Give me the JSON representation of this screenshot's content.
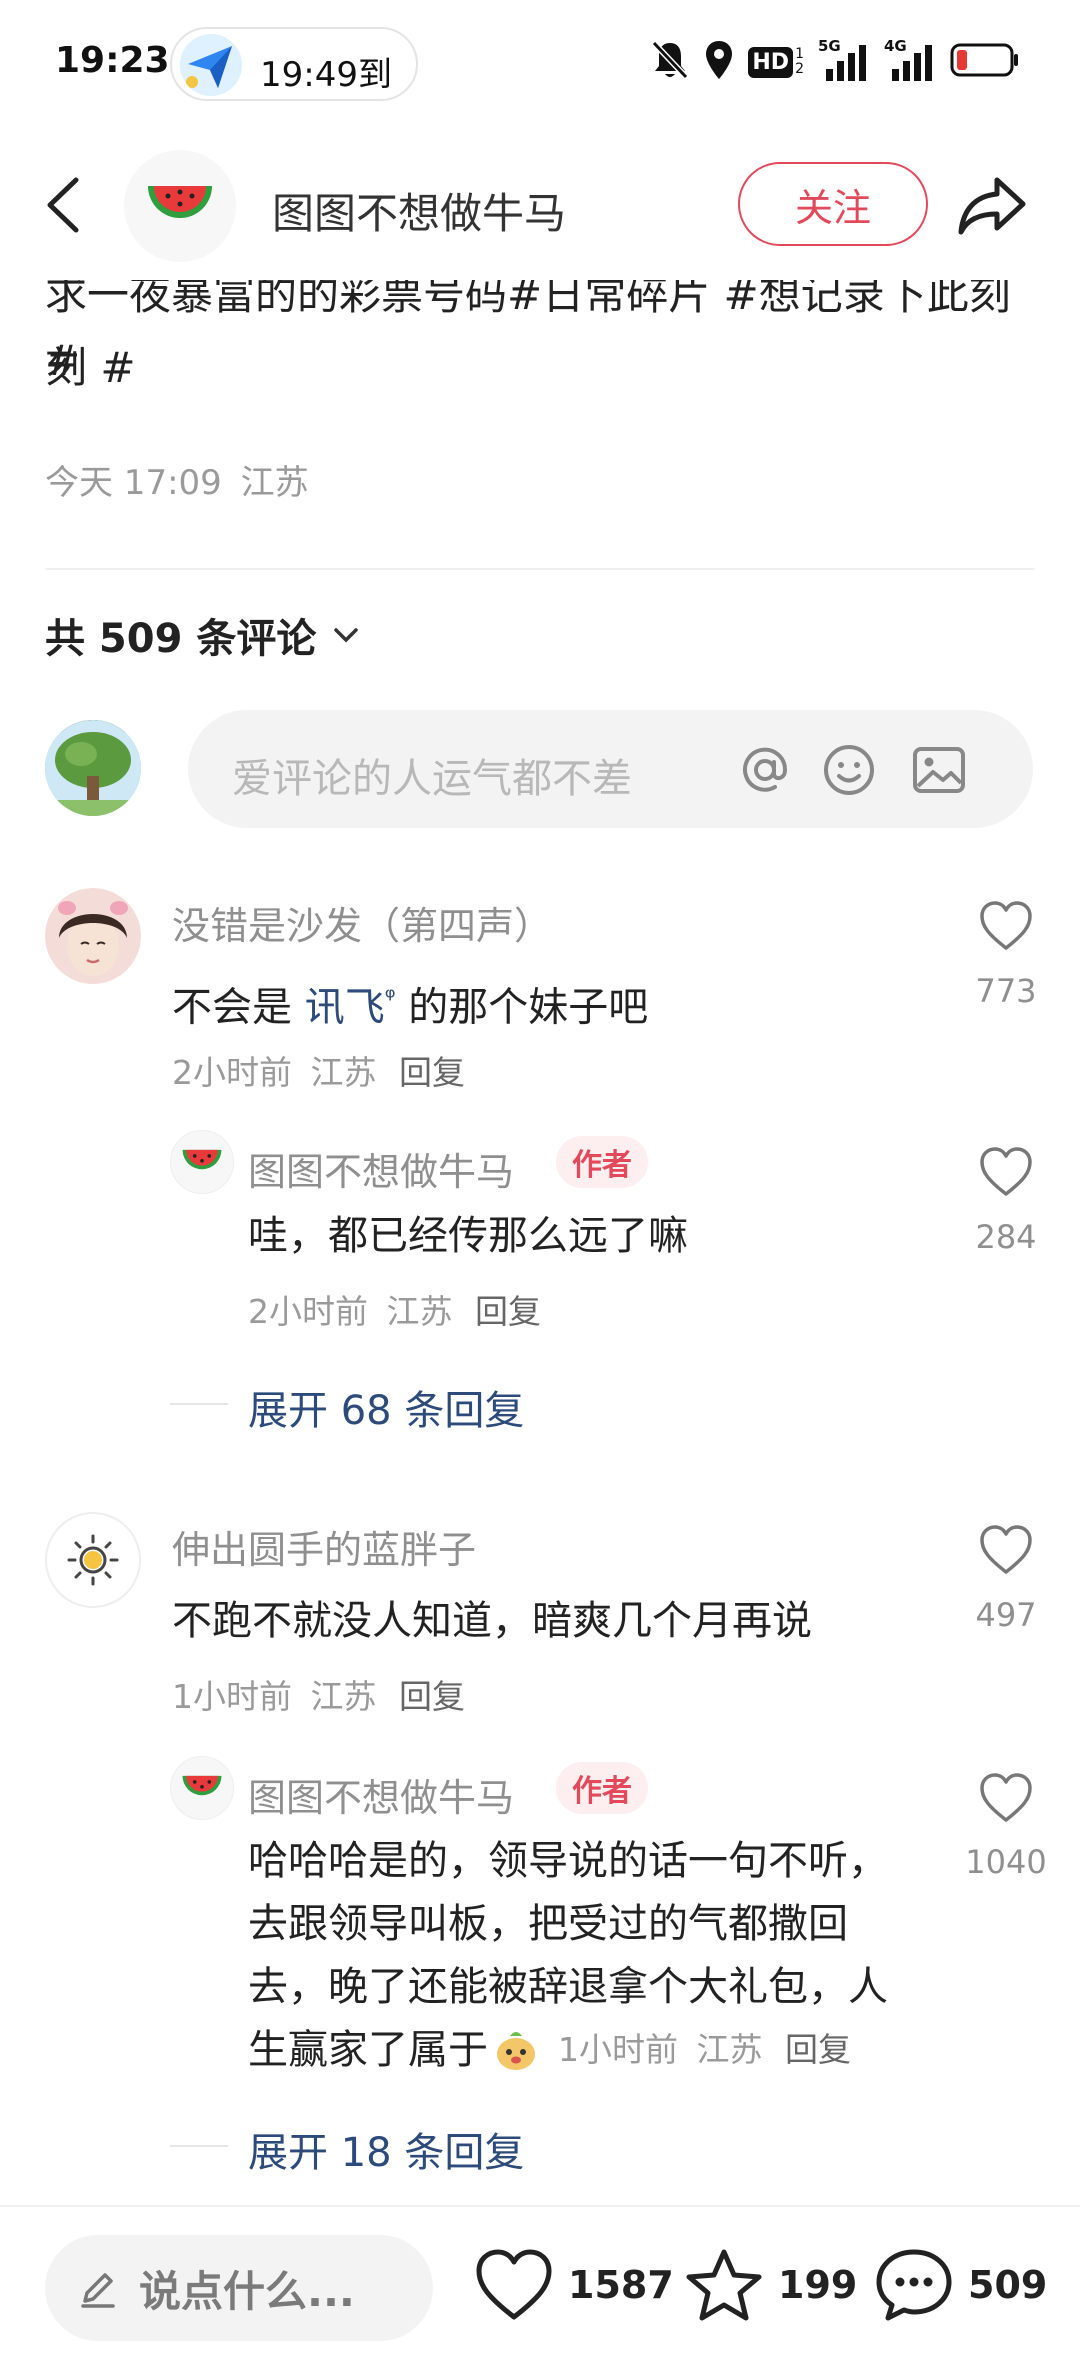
{
  "status_bar": {
    "time": "19:23",
    "pill_text": "19:49到",
    "icons": [
      "bell-muted-icon",
      "location-icon",
      "hd-icon",
      "signal-5g-icon",
      "signal-4g-icon",
      "battery-low-icon"
    ],
    "hd_label": "HD",
    "sim1": "1",
    "sim2": "2",
    "net1": "5G",
    "net2": "4G"
  },
  "header": {
    "author_name": "图图不想做牛马",
    "follow_label": "关注",
    "avatar_icon": "watermelon-icon"
  },
  "post": {
    "text_tail": "求一夜暴富的的彩票号码#日常碎片 #想记录下此刻 #",
    "time": "今天 17:09",
    "location": "江苏"
  },
  "comments_section": {
    "count_label": "共 509 条评论",
    "input_placeholder": "爱评论的人运气都不差",
    "comments": [
      {
        "user": "没错是沙发（第四声）",
        "text_before": "不会是 ",
        "link_word": "讯飞",
        "link_sup": "ᵠ",
        "text_after": " 的那个妹子吧",
        "time": "2小时前",
        "location": "江苏",
        "reply_label": "回复",
        "likes": "773",
        "reply": {
          "user": "图图不想做牛马",
          "badge": "作者",
          "text": "哇，都已经传那么远了嘛",
          "time": "2小时前",
          "location": "江苏",
          "reply_label": "回复",
          "likes": "284"
        },
        "expand_label": "展开 68 条回复"
      },
      {
        "user": "伸出圆手的蓝胖子",
        "text": "不跑不就没人知道，暗爽几个月再说",
        "time": "1小时前",
        "location": "江苏",
        "reply_label": "回复",
        "likes": "497",
        "reply": {
          "user": "图图不想做牛马",
          "badge": "作者",
          "line1": "哈哈哈是的，领导说的话一句不听，",
          "line2": "去跟领导叫板，把受过的气都撒回",
          "line3": "去，晚了还能被辞退拿个大礼包，人",
          "line4": "生赢家了属于",
          "time": "1小时前",
          "location": "江苏",
          "reply_label": "回复",
          "likes": "1040"
        },
        "expand_label": "展开 18 条回复"
      }
    ]
  },
  "bottom_bar": {
    "say_placeholder": "说点什么...",
    "likes": "1587",
    "favorites": "199",
    "comments": "509"
  },
  "colors": {
    "accent": "#e24a5c",
    "link": "#2c4a7a",
    "muted": "#9a9a9a"
  }
}
